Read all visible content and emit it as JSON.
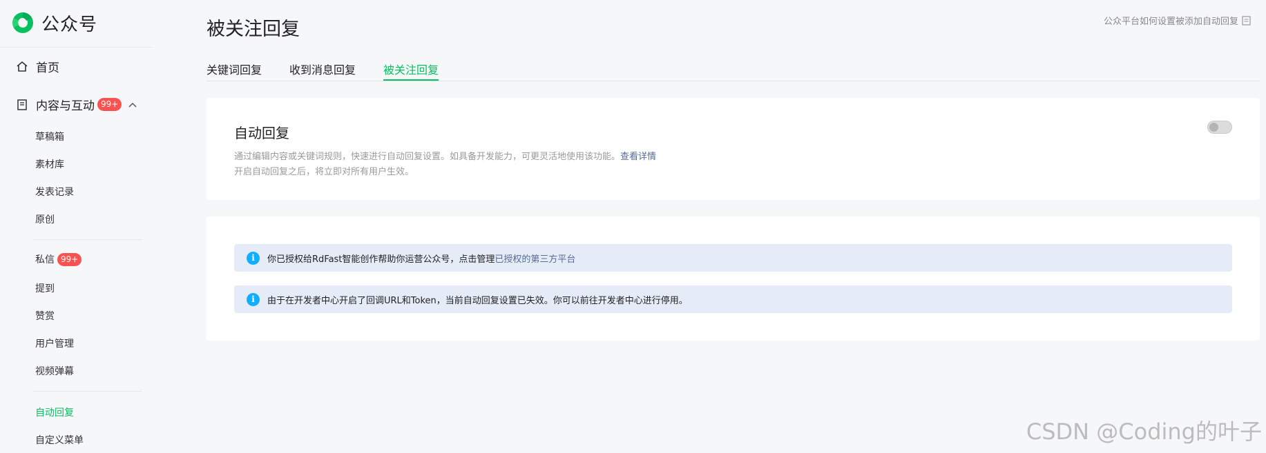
{
  "brand": {
    "name": "公众号",
    "accent": "#07c160"
  },
  "sidebar": {
    "home": "首页",
    "content": {
      "label": "内容与互动",
      "badge": "99+"
    },
    "content_items": [
      "草稿箱",
      "素材库",
      "发表记录",
      "原创"
    ],
    "message": {
      "label": "私信",
      "badge": "99+"
    },
    "items_b": [
      "提到",
      "赞赏",
      "用户管理",
      "视频弹幕"
    ],
    "items_c": [
      "自动回复",
      "自定义菜单"
    ]
  },
  "page": {
    "title": "被关注回复",
    "help_link": "公众平台如何设置被添加自动回复"
  },
  "tabs": [
    "关键词回复",
    "收到消息回复",
    "被关注回复"
  ],
  "auto_reply": {
    "title": "自动回复",
    "desc_line1": "通过编辑内容或关键词规则，快速进行自动回复设置。如具备开发能力，可更灵活地使用该功能。",
    "desc_link": "查看详情",
    "desc_line2": "开启自动回复之后，将立即对所有用户生效。",
    "enabled": false
  },
  "notices": {
    "n1_text": "你已授权给RdFast智能创作帮助你运营公众号，点击管理",
    "n1_link": "已授权的第三方平台",
    "n2_text": "由于在开发者中心开启了回调URL和Token，当前自动回复设置已失效。你可以前往开发者中心进行停用。"
  },
  "watermark": "CSDN @Coding的叶子"
}
